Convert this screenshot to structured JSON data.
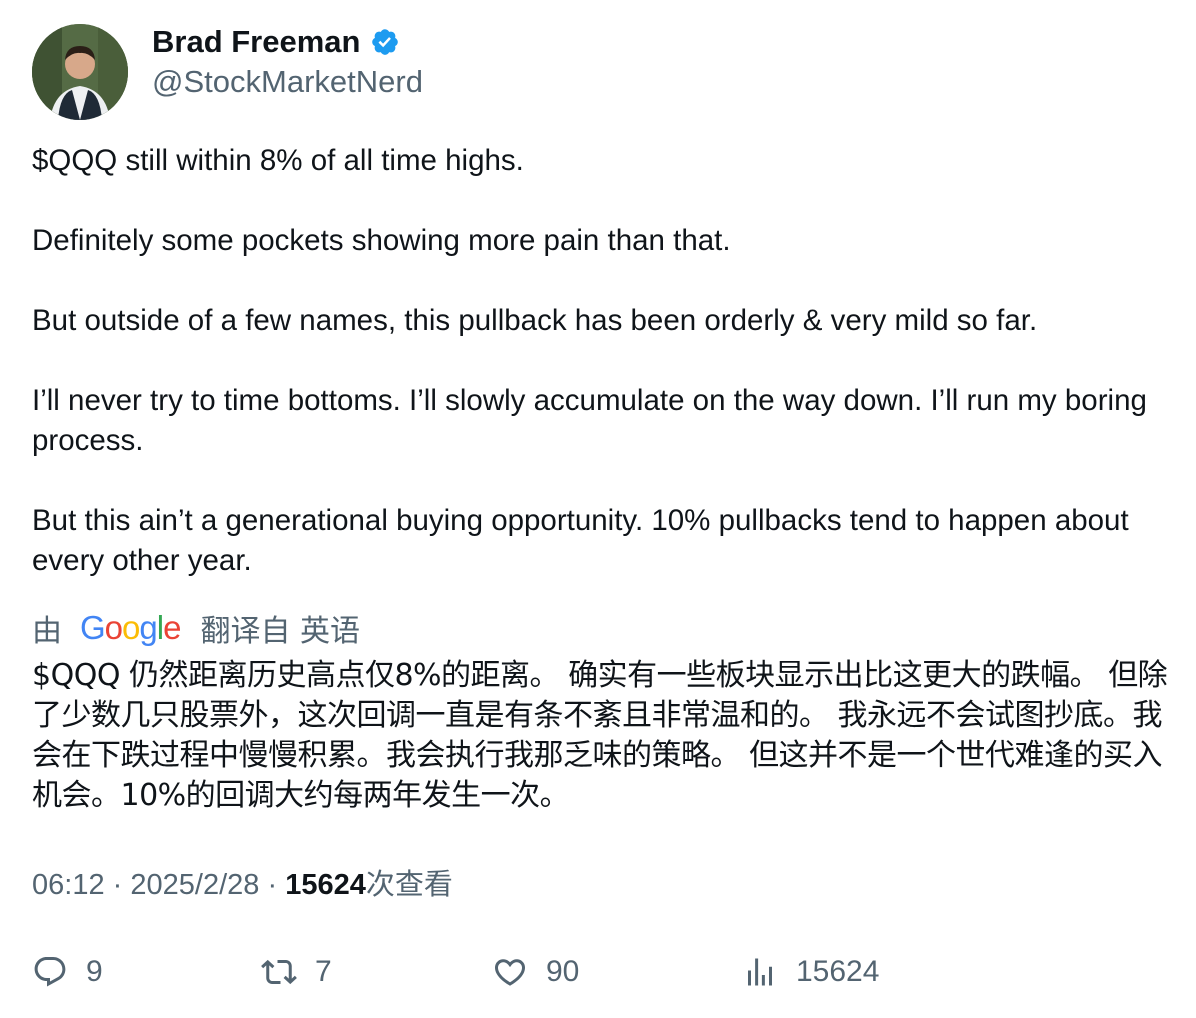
{
  "author": {
    "name": "Brad Freeman",
    "handle": "@StockMarketNerd",
    "verified": true,
    "avatar_icon": "profile-photo"
  },
  "tweet": {
    "paragraphs": [
      "$QQQ still within 8% of all time highs.",
      "Definitely some pockets showing more pain than that.",
      "But outside of a few names, this pullback has been orderly & very mild so far.",
      "I’ll never try to time bottoms. I’ll slowly accumulate on the way down. I’ll run my boring process.",
      "But this ain’t a generational buying opportunity. 10% pullbacks tend to happen about every other year."
    ]
  },
  "translation": {
    "by_label": "由",
    "provider": "Google",
    "from_label": "翻译自 英语",
    "text": "$QQQ 仍然距离历史高点仅8%的距离。 确实有一些板块显示出比这更大的跌幅。 但除了少数几只股票外，这次回调一直是有条不紊且非常温和的。 我永远不会试图抄底。我会在下跌过程中慢慢积累。我会执行我那乏味的策略。 但这并不是一个世代难逢的买入机会。10%的回调大约每两年发生一次。"
  },
  "meta": {
    "time": "06:12",
    "separator": "·",
    "date": "2025/2/28",
    "views_count": "15624",
    "views_label": "次查看"
  },
  "actions": {
    "replies": "9",
    "retweets": "7",
    "likes": "90",
    "views": "15624"
  },
  "colors": {
    "text": "#0f1419",
    "secondary": "#536471",
    "verified_blue": "#1d9bf0",
    "google_blue": "#4285f4",
    "google_red": "#ea4335",
    "google_yellow": "#fbbc05",
    "google_green": "#34a853"
  }
}
